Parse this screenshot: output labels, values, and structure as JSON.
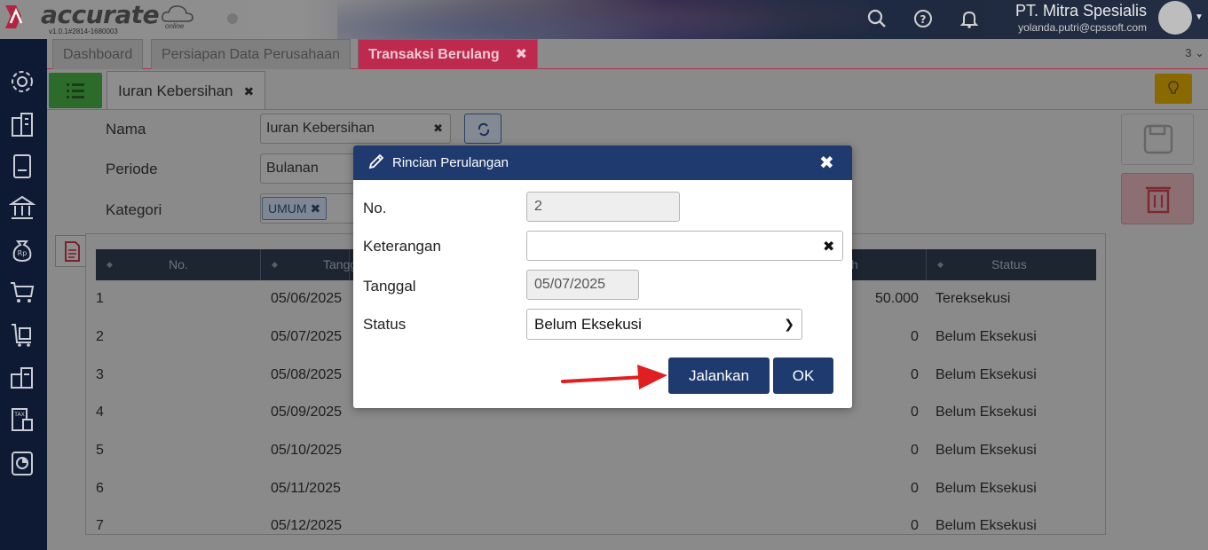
{
  "brand": {
    "logo_text": "accurate",
    "logo_sub": "online",
    "version": "v1.0.1#2814-1680003"
  },
  "header": {
    "company_name": "PT. Mitra Spesialis",
    "user_email": "yolanda.putri@cpssoft.com",
    "icons": [
      "search-icon",
      "help-icon",
      "bell-icon"
    ]
  },
  "tabs": [
    {
      "label": "Dashboard"
    },
    {
      "label": "Persiapan Data Perusahaan"
    },
    {
      "label": "Transaksi Berulang",
      "close": "✖"
    }
  ],
  "tab_count": "3",
  "sidebar_icons": [
    "settings-icon",
    "company-icon",
    "ledger-icon",
    "bank-icon",
    "cash-bag-icon",
    "cart-icon",
    "purchase-icon",
    "warehouse-icon",
    "tax-icon",
    "report-icon"
  ],
  "document": {
    "tab_label": "Iuran Kebersihan",
    "tab_close": "✖",
    "form": {
      "nama_label": "Nama",
      "nama_value": "Iuran Kebersihan",
      "periode_label": "Periode",
      "periode_value": "Bulanan",
      "kategori_label": "Kategori",
      "kategori_tag": "UMUM"
    },
    "table": {
      "columns": [
        "No.",
        "Tangg",
        "h",
        "Status"
      ],
      "rows": [
        {
          "no": "1",
          "tanggal": "05/06/2025",
          "jumlah": "50.000",
          "status": "Tereksekusi"
        },
        {
          "no": "2",
          "tanggal": "05/07/2025",
          "jumlah": "0",
          "status": "Belum Eksekusi"
        },
        {
          "no": "3",
          "tanggal": "05/08/2025",
          "jumlah": "0",
          "status": "Belum Eksekusi"
        },
        {
          "no": "4",
          "tanggal": "05/09/2025",
          "jumlah": "0",
          "status": "Belum Eksekusi"
        },
        {
          "no": "5",
          "tanggal": "05/10/2025",
          "jumlah": "0",
          "status": "Belum Eksekusi"
        },
        {
          "no": "6",
          "tanggal": "05/11/2025",
          "jumlah": "0",
          "status": "Belum Eksekusi"
        },
        {
          "no": "7",
          "tanggal": "05/12/2025",
          "jumlah": "0",
          "status": "Belum Eksekusi"
        }
      ]
    }
  },
  "modal": {
    "title": "Rincian Perulangan",
    "close": "✖",
    "no_label": "No.",
    "no_value": "2",
    "keterangan_label": "Keterangan",
    "keterangan_value": "",
    "keterangan_clear": "✖",
    "tanggal_label": "Tanggal",
    "tanggal_value": "05/07/2025",
    "status_label": "Status",
    "status_value": "Belum Eksekusi",
    "run_button": "Jalankan",
    "ok_button": "OK"
  },
  "colors": {
    "primary": "#1e3a6e",
    "active_tab": "#bd2a4e",
    "arrow": "#e02020",
    "sidebar": "#0e1a33"
  }
}
